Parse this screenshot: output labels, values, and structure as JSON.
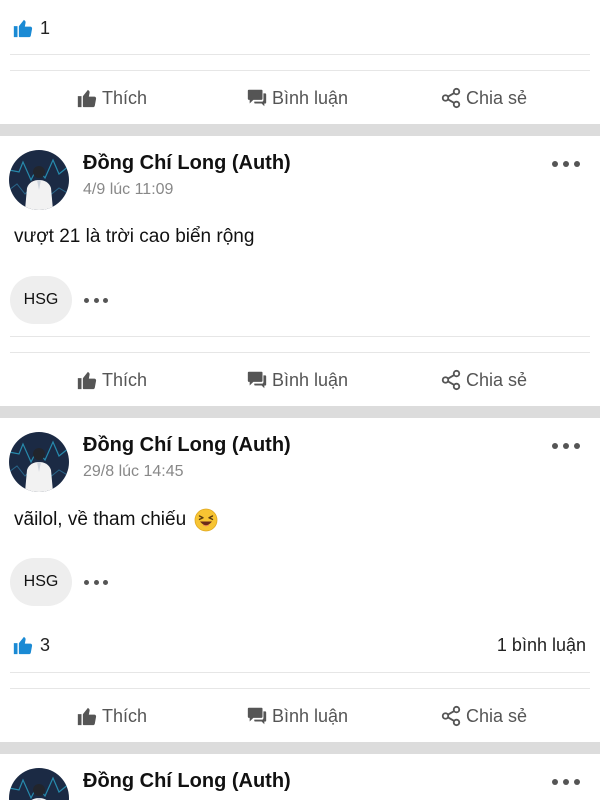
{
  "colors": {
    "like_blue": "#1a8ad4",
    "text_primary": "#111111",
    "text_secondary": "#888888",
    "action_gray": "#555555",
    "divider_gap": "#dcdcdc",
    "pill_bg": "#eeeeee"
  },
  "actions": {
    "like_label": "Thích",
    "comment_label": "Bình luận",
    "share_label": "Chia sẻ",
    "like_icon": "thumbs-up-icon",
    "comment_icon": "comment-icon",
    "share_icon": "share-icon"
  },
  "top_post": {
    "likes": "1"
  },
  "posts": [
    {
      "author": "Đồng Chí Long (Auth)",
      "time": "4/9 lúc 11:09",
      "text": "vượt 21 là trời cao biển rộng",
      "tag": "HSG"
    },
    {
      "author": "Đồng Chí Long (Auth)",
      "time": "29/8 lúc 14:45",
      "text": "vãilol, về tham chiếu",
      "emoji": "laughing-face-emoji",
      "tag": "HSG",
      "likes": "3",
      "comments": "1 bình luận"
    },
    {
      "author": "Đồng Chí Long (Auth)"
    }
  ]
}
